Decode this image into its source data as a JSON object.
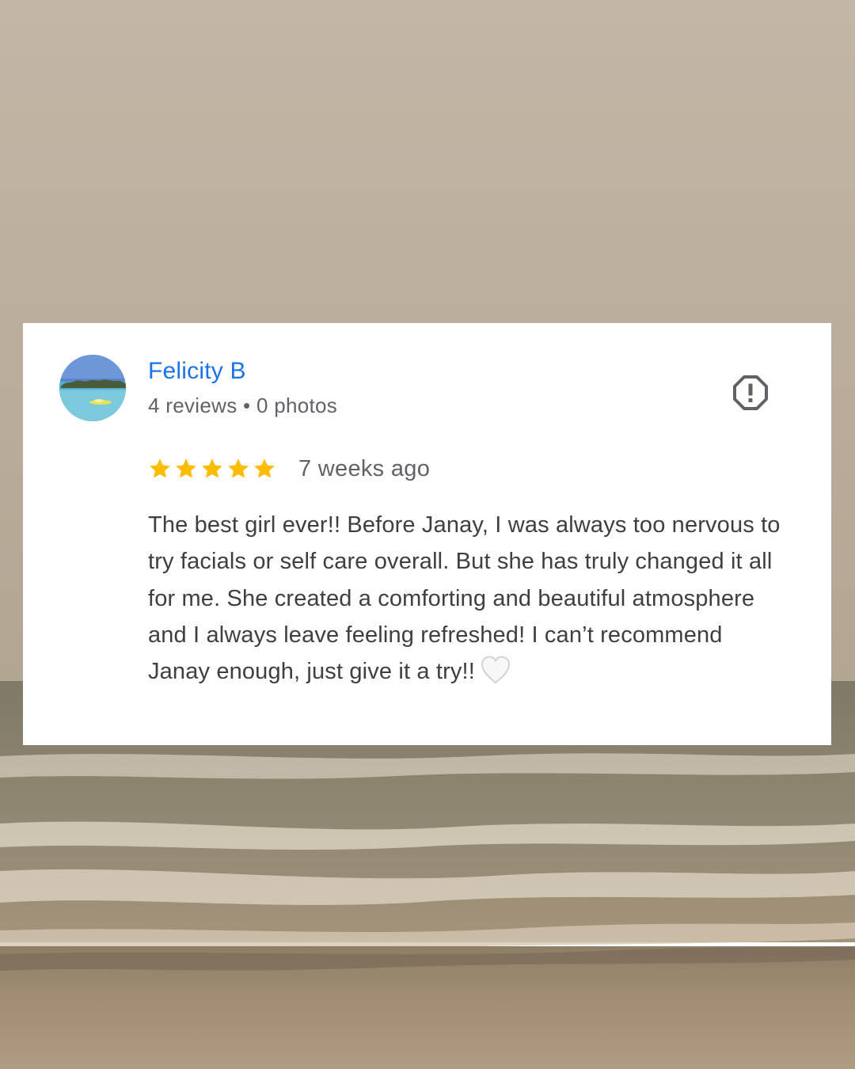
{
  "review": {
    "reviewer_name": "Felicity B",
    "reviewer_meta": "4 reviews • 0 photos",
    "rating": 5,
    "rating_max": 5,
    "date": "7 weeks ago",
    "text": "The best girl ever!! Before Janay, I was always too nervous to try facials or self care overall. But she has truly changed it all for me. She created a comforting and beautiful atmosphere and I always leave feeling refreshed! I can’t recommend Janay enough, just give it a try!!",
    "text_trailing_icon": "white-heart-icon"
  },
  "icons": {
    "flag": "report-exclamation-octagon-icon",
    "star": "star-icon",
    "avatar": "beach-photo-avatar"
  },
  "colors": {
    "name": "#1a73e8",
    "meta": "#5f6368",
    "body_text": "#3c4043",
    "star": "#fbbc04",
    "card_bg": "#ffffff"
  }
}
